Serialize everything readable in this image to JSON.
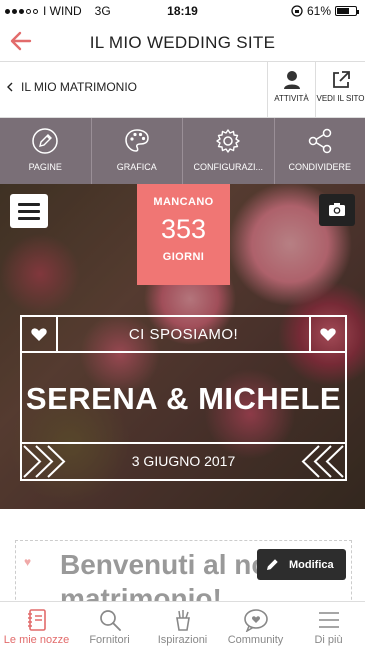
{
  "status_bar": {
    "carrier": "I WIND",
    "network": "3G",
    "time": "18:19",
    "battery": "61%"
  },
  "header": {
    "title": "IL MIO WEDDING SITE",
    "back_icon": "arrow-left-icon",
    "accent_color": "#e26b6b"
  },
  "subnav": {
    "breadcrumb": "IL MIO MATRIMONIO",
    "actions": [
      {
        "label": "ATTIVITÀ",
        "icon": "user-icon"
      },
      {
        "label": "VEDI IL SITO",
        "icon": "external-link-icon"
      }
    ]
  },
  "toolbar": {
    "background": "#7a6f77",
    "items": [
      {
        "label": "PAGINE",
        "icon": "pencil-icon"
      },
      {
        "label": "GRAFICA",
        "icon": "palette-icon"
      },
      {
        "label": "CONFIGURAZI...",
        "icon": "gear-icon"
      },
      {
        "label": "CONDIVIDERE",
        "icon": "share-icon"
      }
    ]
  },
  "hero": {
    "countdown": {
      "label_top": "MANCANO",
      "days": "353",
      "label_bottom": "GIORNI",
      "color": "#f07674"
    },
    "tagline": "CI SPOSIAMO!",
    "names": "SERENA & MICHELE",
    "date": "3 GIUGNO 2017"
  },
  "welcome": {
    "text": "Benvenuti al nostro matrimonio!",
    "edit_label": "Modifica"
  },
  "tabbar": {
    "items": [
      {
        "label": "Le mie nozze",
        "icon": "notebook-icon",
        "active": true
      },
      {
        "label": "Fornitori",
        "icon": "search-icon",
        "active": false
      },
      {
        "label": "Ispirazioni",
        "icon": "ideas-icon",
        "active": false
      },
      {
        "label": "Community",
        "icon": "chat-heart-icon",
        "active": false
      },
      {
        "label": "Di più",
        "icon": "menu-icon",
        "active": false
      }
    ]
  }
}
